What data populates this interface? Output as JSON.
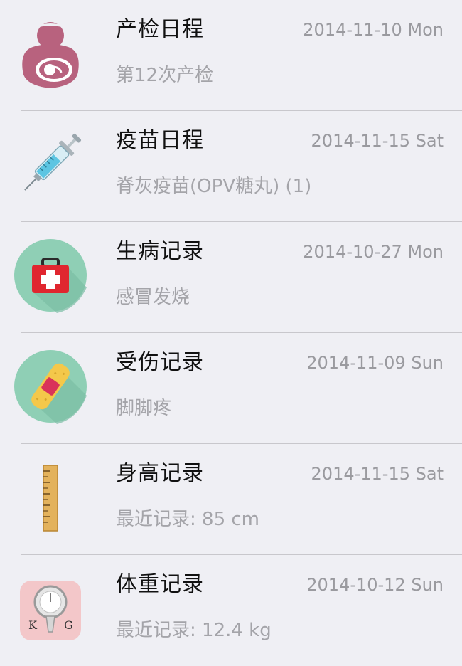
{
  "records": [
    {
      "title": "产检日程",
      "date": "2014-11-10 Mon",
      "subtitle": "第12次产检",
      "icon": "pregnancy-icon"
    },
    {
      "title": "疫苗日程",
      "date": "2014-11-15 Sat",
      "subtitle": "脊灰疫苗(OPV糖丸) (1)",
      "icon": "syringe-icon"
    },
    {
      "title": "生病记录",
      "date": "2014-10-27 Mon",
      "subtitle": "感冒发烧",
      "icon": "first-aid-kit-icon"
    },
    {
      "title": "受伤记录",
      "date": "2014-11-09 Sun",
      "subtitle": "脚脚疼",
      "icon": "bandage-icon"
    },
    {
      "title": "身高记录",
      "date": "2014-11-15 Sat",
      "subtitle": "最近记录: 85 cm",
      "icon": "ruler-icon"
    },
    {
      "title": "体重记录",
      "date": "2014-10-12 Sun",
      "subtitle": "最近记录: 12.4 kg",
      "icon": "weight-scale-icon"
    }
  ],
  "scale_letters": {
    "left": "K",
    "right": "G"
  },
  "colors": {
    "pregnancy": "#b8627e",
    "circle_green": "#8fcfb5",
    "kit_red": "#e0262f",
    "bandage_yellow": "#f4c84a",
    "scale_pink": "#f3c7c9"
  }
}
